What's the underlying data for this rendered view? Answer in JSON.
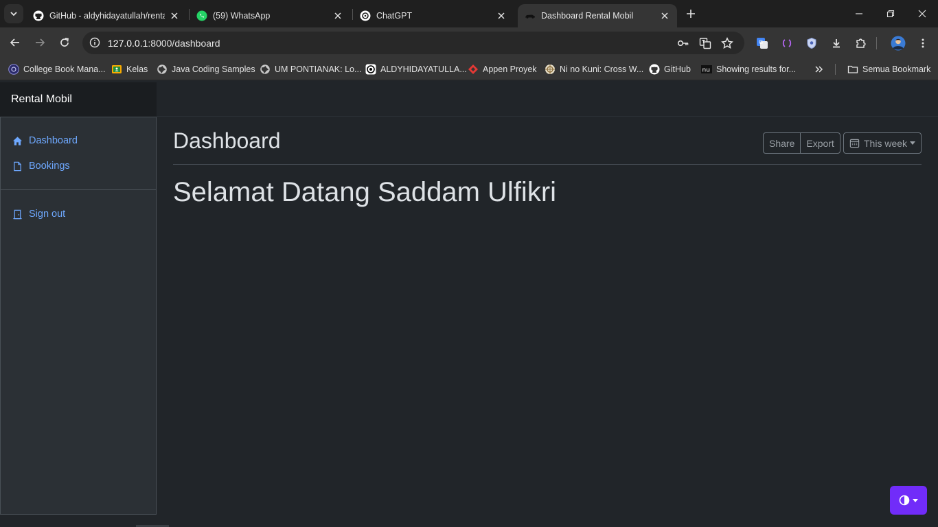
{
  "browser": {
    "tabs": [
      {
        "title": "GitHub - aldyhidayatullah/rental",
        "favicon": "github-icon"
      },
      {
        "title": "(59) WhatsApp",
        "favicon": "whatsapp-icon"
      },
      {
        "title": "ChatGPT",
        "favicon": "openai-icon"
      },
      {
        "title": "Dashboard Rental Mobil",
        "favicon": "car-icon",
        "active": true
      }
    ],
    "url": {
      "host": "127.0.0.1",
      "path": ":8000/dashboard"
    },
    "bookmarks": [
      {
        "label": "College Book Mana...",
        "favicon": "book-icon"
      },
      {
        "label": "Kelas",
        "favicon": "classroom-icon"
      },
      {
        "label": "Java Coding Samples",
        "favicon": "globe-icon"
      },
      {
        "label": "UM PONTIANAK: Lo...",
        "favicon": "globe-icon"
      },
      {
        "label": "ALDYHIDAYATULLA...",
        "favicon": "target-icon"
      },
      {
        "label": "Appen Proyek",
        "favicon": "appen-icon"
      },
      {
        "label": "Ni no Kuni: Cross W...",
        "favicon": "game-icon"
      },
      {
        "label": "GitHub",
        "favicon": "github-icon"
      },
      {
        "label": "Showing results for...",
        "favicon": "nu-icon"
      }
    ],
    "all_bookmarks_label": "Semua Bookmark",
    "colors": {
      "tabstrip": "#1f1f1f",
      "toolbar": "#353535",
      "omnibox": "#282828"
    }
  },
  "app": {
    "brand": "Rental Mobil",
    "sidebar": {
      "items": [
        {
          "label": "Dashboard",
          "icon": "house-icon"
        },
        {
          "label": "Bookings",
          "icon": "file-icon"
        }
      ],
      "signout": {
        "label": "Sign out",
        "icon": "door-icon"
      }
    },
    "header": {
      "title": "Dashboard",
      "share_label": "Share",
      "export_label": "Export",
      "period_label": "This week"
    },
    "welcome": "Selamat Datang Saddam Ulfikri",
    "theme_toggle": {
      "icon": "circle-half-icon",
      "accent": "#712cf9"
    },
    "colors": {
      "link": "#6ea8fe",
      "body_bg": "#212529",
      "sidebar_bg": "#2b3035"
    }
  }
}
